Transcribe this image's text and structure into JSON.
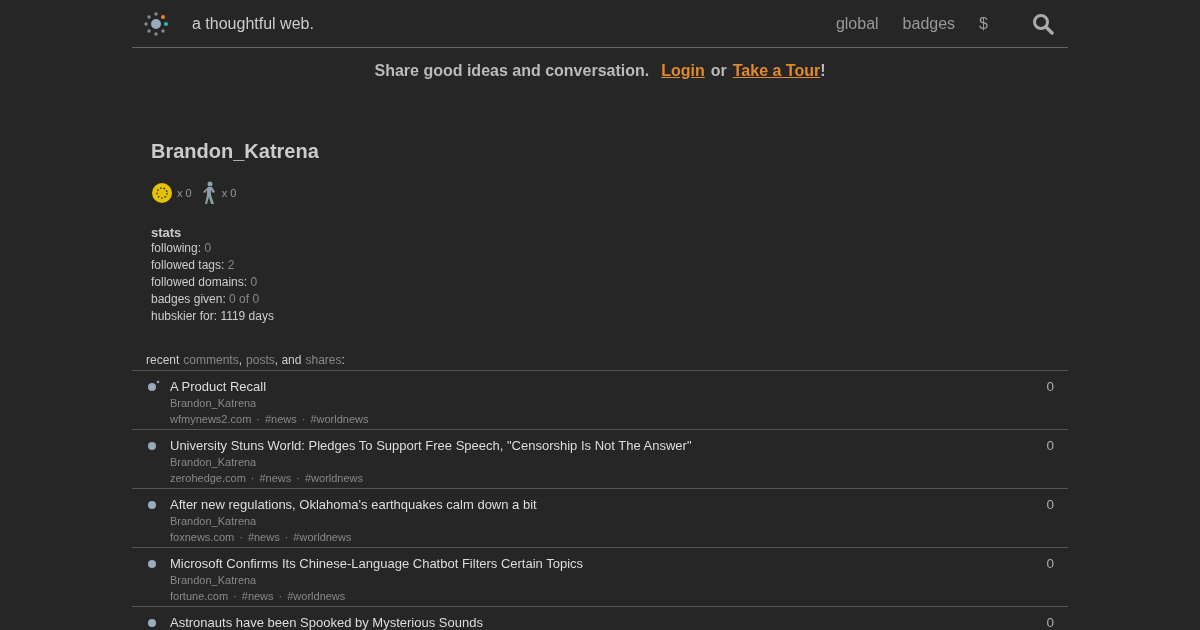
{
  "header": {
    "tagline": "a thoughtful web.",
    "nav": [
      "global",
      "badges",
      "$"
    ]
  },
  "banner": {
    "text": "Share good ideas and conversation.",
    "login": "Login",
    "or": "or",
    "tour": "Take a Tour",
    "end": "!"
  },
  "profile": {
    "name": "Brandon_Katrena",
    "badges": [
      {
        "kind": "gold",
        "count": "x 0"
      },
      {
        "kind": "walker",
        "count": "x 0"
      }
    ],
    "stats_title": "stats",
    "stats": [
      {
        "label": "following:",
        "value": "0",
        "dim": true
      },
      {
        "label": "followed tags:",
        "value": "2",
        "dim": true
      },
      {
        "label": "followed domains:",
        "value": "0",
        "dim": true
      },
      {
        "label": "badges given:",
        "value": "0 of 0",
        "dim": true
      },
      {
        "label": "hubskier for:",
        "value": "1119 days",
        "dim": false
      }
    ]
  },
  "recent": [
    {
      "kind": "text",
      "text": "recent"
    },
    {
      "kind": "link",
      "text": "comments"
    },
    {
      "kind": "text",
      "text": ","
    },
    {
      "kind": "link",
      "text": "posts"
    },
    {
      "kind": "text",
      "text": ", and"
    },
    {
      "kind": "link",
      "text": "shares"
    },
    {
      "kind": "text",
      "text": ":"
    }
  ],
  "meta_separator": "·",
  "feed": [
    {
      "kind": "shared",
      "title": "A Product Recall",
      "author": "Brandon_Katrena",
      "domain": "wfmynews2.com",
      "tags": [
        "#news",
        "#worldnews"
      ],
      "score": "0"
    },
    {
      "kind": "post",
      "title": "University Stuns World: Pledges To Support Free Speech, \"Censorship Is Not The Answer\"",
      "author": "Brandon_Katrena",
      "domain": "zerohedge.com",
      "tags": [
        "#news",
        "#worldnews"
      ],
      "score": "0"
    },
    {
      "kind": "post",
      "title": "After new regulations, Oklahoma's earthquakes calm down a bit",
      "author": "Brandon_Katrena",
      "domain": "foxnews.com",
      "tags": [
        "#news",
        "#worldnews"
      ],
      "score": "0"
    },
    {
      "kind": "post",
      "title": "Microsoft Confirms Its Chinese-Language Chatbot Filters Certain Topics",
      "author": "Brandon_Katrena",
      "domain": "fortune.com",
      "tags": [
        "#news",
        "#worldnews"
      ],
      "score": "0"
    },
    {
      "kind": "post",
      "title": "Astronauts have been Spooked by Mysterious Sounds",
      "score": "0"
    }
  ]
}
